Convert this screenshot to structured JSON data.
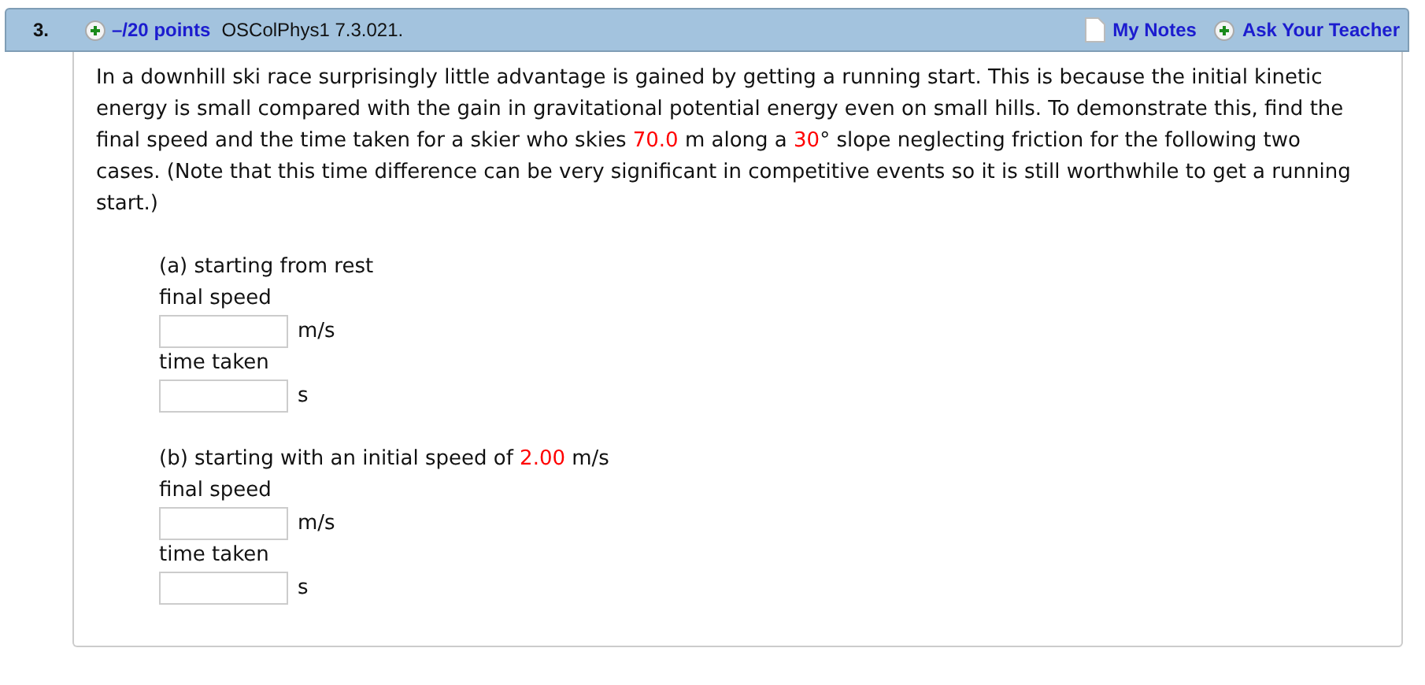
{
  "question": {
    "number": "3.",
    "points": "–/20 points",
    "source": "OSColPhys1 7.3.021.",
    "links": [
      {
        "kind": "notes",
        "label": "My Notes"
      },
      {
        "kind": "ask",
        "label": "Ask Your Teacher"
      }
    ]
  },
  "prompt": [
    {
      "kind": "text",
      "text": "In a downhill ski race surprisingly little advantage is gained by getting a running start. This is because the initial kinetic energy is small compared with the gain in gravitational potential energy even on small hills. To demonstrate this, find the final speed and the time taken for a skier who skies "
    },
    {
      "kind": "value",
      "text": "70.0"
    },
    {
      "kind": "text",
      "text": " m along a "
    },
    {
      "kind": "value",
      "text": "30"
    },
    {
      "kind": "text",
      "text": "° slope neglecting friction for the following two cases. (Note that this time difference can be very significant in competitive events so it is still worthwhile to get a running start.)"
    }
  ],
  "parts": [
    {
      "title": [
        {
          "kind": "text",
          "text": "(a) starting from rest"
        }
      ],
      "answers": [
        {
          "label": "final speed",
          "unit": "m/s"
        },
        {
          "label": "time taken",
          "unit": "s"
        }
      ]
    },
    {
      "title": [
        {
          "kind": "text",
          "text": "(b) starting with an initial speed of "
        },
        {
          "kind": "value",
          "text": "2.00"
        },
        {
          "kind": "text",
          "text": " m/s"
        }
      ],
      "answers": [
        {
          "label": "final speed",
          "unit": "m/s"
        },
        {
          "label": "time taken",
          "unit": "s"
        }
      ]
    }
  ]
}
